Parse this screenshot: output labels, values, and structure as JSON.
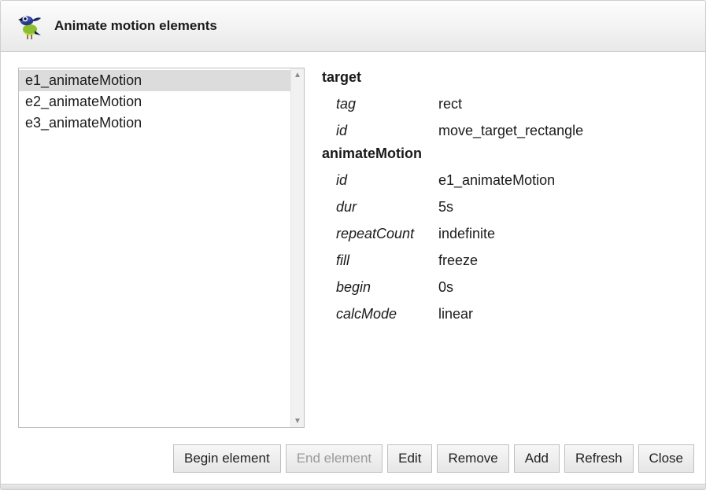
{
  "dialog": {
    "title": "Animate motion elements"
  },
  "list": {
    "items": [
      {
        "label": "e1_animateMotion",
        "selected": true
      },
      {
        "label": "e2_animateMotion",
        "selected": false
      },
      {
        "label": "e3_animateMotion",
        "selected": false
      }
    ]
  },
  "details": {
    "groups": [
      {
        "heading": "target",
        "rows": [
          {
            "key": "tag",
            "value": "rect"
          },
          {
            "key": "id",
            "value": "move_target_rectangle"
          }
        ]
      },
      {
        "heading": "animateMotion",
        "rows": [
          {
            "key": "id",
            "value": "e1_animateMotion"
          },
          {
            "key": "dur",
            "value": "5s"
          },
          {
            "key": "repeatCount",
            "value": "indefinite"
          },
          {
            "key": "fill",
            "value": "freeze"
          },
          {
            "key": "begin",
            "value": "0s"
          },
          {
            "key": "calcMode",
            "value": "linear"
          }
        ]
      }
    ]
  },
  "buttons": {
    "begin": {
      "label": "Begin element",
      "enabled": true
    },
    "end": {
      "label": "End element",
      "enabled": false
    },
    "edit": {
      "label": "Edit",
      "enabled": true
    },
    "remove": {
      "label": "Remove",
      "enabled": true
    },
    "add": {
      "label": "Add",
      "enabled": true
    },
    "refresh": {
      "label": "Refresh",
      "enabled": true
    },
    "close": {
      "label": "Close",
      "enabled": true
    }
  }
}
